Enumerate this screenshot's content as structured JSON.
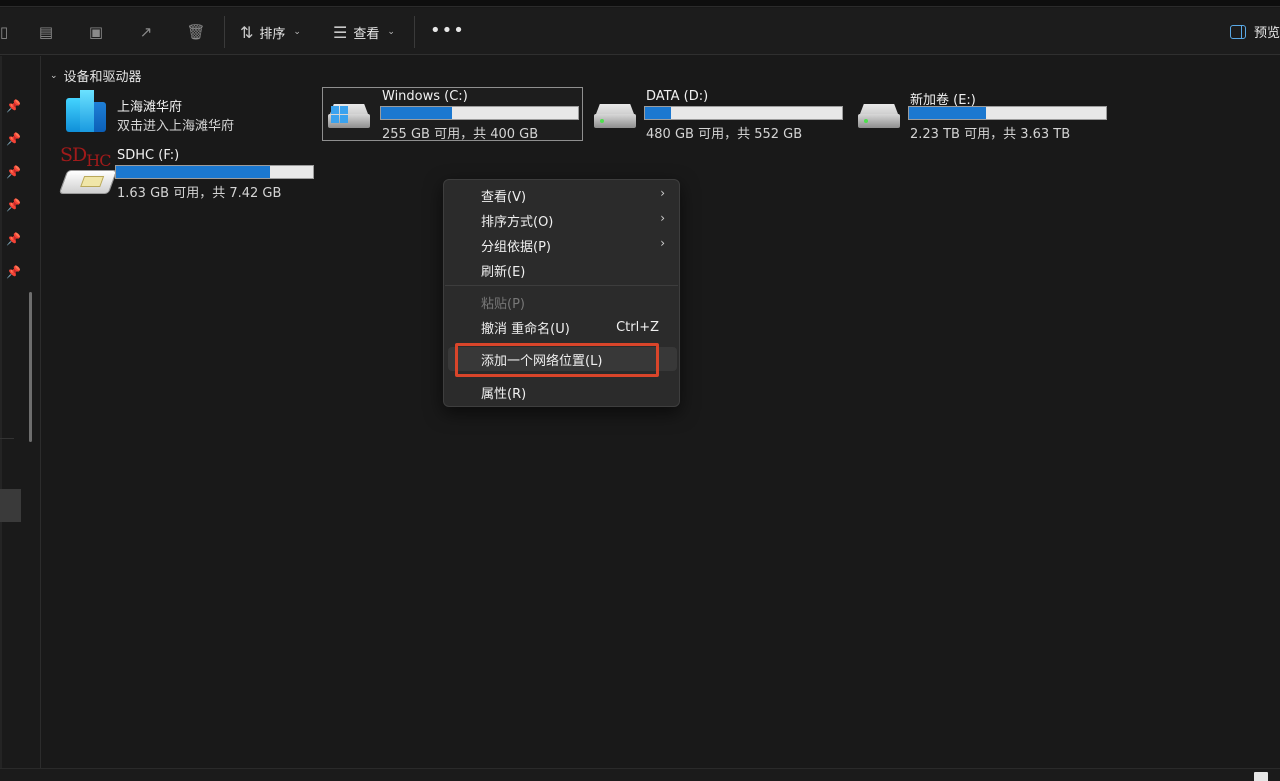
{
  "toolbar": {
    "sort_label": "排序",
    "view_label": "查看",
    "preview_label": "预览",
    "icons": [
      "paste-icon",
      "rename-icon",
      "share-icon",
      "delete-icon",
      "sort-icon",
      "view-icon",
      "more-icon",
      "preview-pane-icon"
    ]
  },
  "group": {
    "title": "设备和驱动器"
  },
  "items": {
    "app": {
      "name": "上海滩华府",
      "sub": "双击进入上海滩华府"
    },
    "c_drive": {
      "name": "Windows (C:)",
      "sub": "255 GB 可用，共 400 GB",
      "used_fraction": 0.36
    },
    "d_drive": {
      "name": "DATA (D:)",
      "sub": "480 GB 可用，共 552 GB",
      "used_fraction": 0.13
    },
    "e_drive": {
      "name": "新加卷 (E:)",
      "sub": "2.23 TB 可用，共 3.63 TB",
      "used_fraction": 0.39
    },
    "f_drive": {
      "name": "SDHC (F:)",
      "sub": "1.63 GB 可用，共 7.42 GB",
      "used_fraction": 0.78,
      "icon_text_a": "SD",
      "icon_text_b": "HC"
    }
  },
  "context_menu": {
    "items": [
      {
        "label": "查看(V)",
        "has_submenu": true
      },
      {
        "label": "排序方式(O)",
        "has_submenu": true
      },
      {
        "label": "分组依据(P)",
        "has_submenu": true
      },
      {
        "label": "刷新(E)"
      },
      {
        "label": "粘贴(P)",
        "disabled": true
      },
      {
        "label": "撤消 重命名(U)",
        "shortcut": "Ctrl+Z"
      },
      {
        "label": "添加一个网络位置(L)",
        "highlighted": true
      },
      {
        "label": "属性(R)"
      }
    ],
    "arrow": "›"
  },
  "colors": {
    "accent": "#1b78d0",
    "highlight_box": "#d9452a",
    "background": "#191919"
  }
}
